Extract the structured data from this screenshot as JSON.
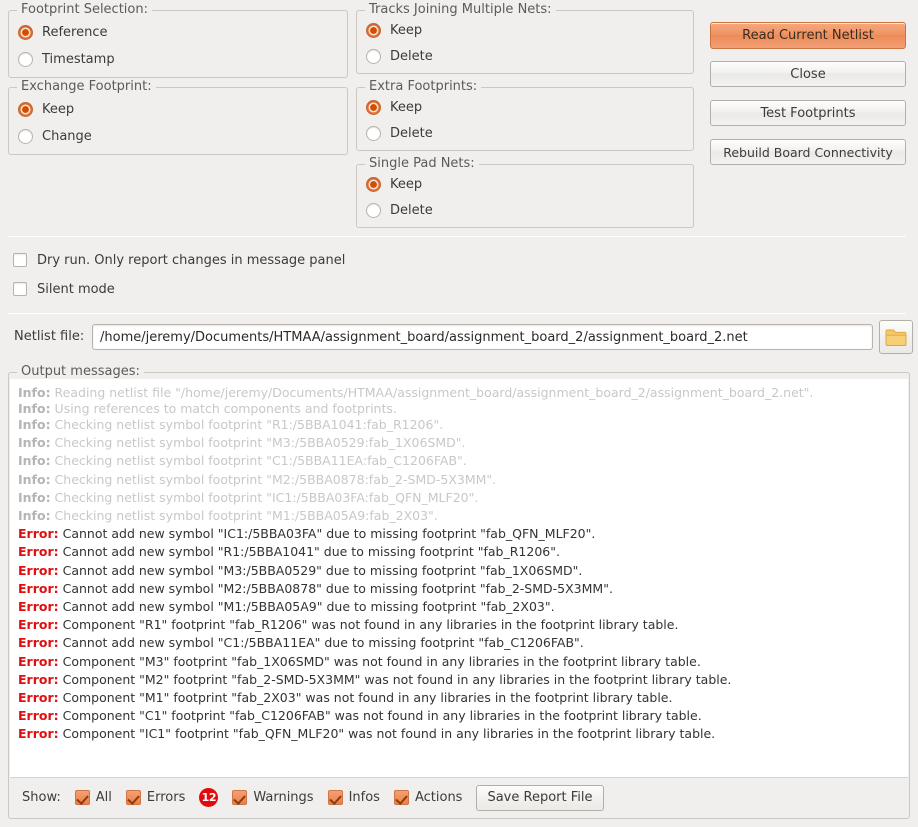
{
  "dialog": {
    "accent_color": "#ec8a57",
    "error_color": "#e10f0f",
    "info_color": "#c8c8c8"
  },
  "groups": {
    "footprint_selection": {
      "title": "Footprint Selection:",
      "options": [
        {
          "label": "Reference",
          "selected": true
        },
        {
          "label": "Timestamp",
          "selected": false
        }
      ]
    },
    "exchange_footprint": {
      "title": "Exchange Footprint:",
      "options": [
        {
          "label": "Keep",
          "selected": true
        },
        {
          "label": "Change",
          "selected": false
        }
      ]
    },
    "tracks_joining": {
      "title": "Tracks Joining Multiple Nets:",
      "options": [
        {
          "label": "Keep",
          "selected": true
        },
        {
          "label": "Delete",
          "selected": false
        }
      ]
    },
    "extra_footprints": {
      "title": "Extra Footprints:",
      "options": [
        {
          "label": "Keep",
          "selected": true
        },
        {
          "label": "Delete",
          "selected": false
        }
      ]
    },
    "single_pad_nets": {
      "title": "Single Pad Nets:",
      "options": [
        {
          "label": "Keep",
          "selected": true
        },
        {
          "label": "Delete",
          "selected": false
        }
      ]
    }
  },
  "options": {
    "dry_run": {
      "label": "Dry run. Only report changes in message panel",
      "checked": false
    },
    "silent_mode": {
      "label": "Silent mode",
      "checked": false
    }
  },
  "buttons": {
    "read_current_netlist": "Read Current Netlist",
    "close": "Close",
    "test_footprints": "Test Footprints",
    "rebuild_board_connectivity": "Rebuild Board Connectivity",
    "save_report_file": "Save Report File",
    "browse_icon": "folder-icon"
  },
  "netlist": {
    "label": "Netlist file:",
    "value": "/home/jeremy/Documents/HTMAA/assignment_board/assignment_board_2/assignment_board_2.net",
    "placeholder": ""
  },
  "output": {
    "title": "Output messages:",
    "messages": [
      {
        "level": "Info:",
        "type": "info",
        "tight": true,
        "text": " Reading netlist file \"/home/jeremy/Documents/HTMAA/assignment_board/assignment_board_2/assignment_board_2.net\"."
      },
      {
        "level": "Info:",
        "type": "info",
        "tight": true,
        "text": " Using references to match components and footprints."
      },
      {
        "level": "Info:",
        "type": "info",
        "tight": false,
        "text": " Checking netlist symbol footprint \"R1:/5BBA1041:fab_R1206\"."
      },
      {
        "level": "Info:",
        "type": "info",
        "tight": false,
        "text": " Checking netlist symbol footprint \"M3:/5BBA0529:fab_1X06SMD\"."
      },
      {
        "level": "Info:",
        "type": "info",
        "tight": false,
        "text": " Checking netlist symbol footprint \"C1:/5BBA11EA:fab_C1206FAB\"."
      },
      {
        "level": "Info:",
        "type": "info",
        "tight": false,
        "text": " Checking netlist symbol footprint \"M2:/5BBA0878:fab_2-SMD-5X3MM\"."
      },
      {
        "level": "Info:",
        "type": "info",
        "tight": false,
        "text": " Checking netlist symbol footprint \"IC1:/5BBA03FA:fab_QFN_MLF20\"."
      },
      {
        "level": "Info:",
        "type": "info",
        "tight": false,
        "text": " Checking netlist symbol footprint \"M1:/5BBA05A9:fab_2X03\"."
      },
      {
        "level": "Error:",
        "type": "error",
        "tight": false,
        "text": " Cannot add new symbol \"IC1:/5BBA03FA\" due to missing footprint \"fab_QFN_MLF20\"."
      },
      {
        "level": "Error:",
        "type": "error",
        "tight": false,
        "text": " Cannot add new symbol \"R1:/5BBA1041\" due to missing footprint \"fab_R1206\"."
      },
      {
        "level": "Error:",
        "type": "error",
        "tight": false,
        "text": " Cannot add new symbol \"M3:/5BBA0529\" due to missing footprint \"fab_1X06SMD\"."
      },
      {
        "level": "Error:",
        "type": "error",
        "tight": false,
        "text": " Cannot add new symbol \"M2:/5BBA0878\" due to missing footprint \"fab_2-SMD-5X3MM\"."
      },
      {
        "level": "Error:",
        "type": "error",
        "tight": false,
        "text": " Cannot add new symbol \"M1:/5BBA05A9\" due to missing footprint \"fab_2X03\"."
      },
      {
        "level": "Error:",
        "type": "error",
        "tight": false,
        "text": " Component \"R1\" footprint \"fab_R1206\" was not found in any libraries in the footprint library table."
      },
      {
        "level": "Error:",
        "type": "error",
        "tight": false,
        "text": " Cannot add new symbol \"C1:/5BBA11EA\" due to missing footprint \"fab_C1206FAB\"."
      },
      {
        "level": "Error:",
        "type": "error",
        "tight": false,
        "text": " Component \"M3\" footprint \"fab_1X06SMD\" was not found in any libraries in the footprint library table."
      },
      {
        "level": "Error:",
        "type": "error",
        "tight": false,
        "text": " Component \"M2\" footprint \"fab_2-SMD-5X3MM\" was not found in any libraries in the footprint library table."
      },
      {
        "level": "Error:",
        "type": "error",
        "tight": false,
        "text": " Component \"M1\" footprint \"fab_2X03\" was not found in any libraries in the footprint library table."
      },
      {
        "level": "Error:",
        "type": "error",
        "tight": false,
        "text": " Component \"C1\" footprint \"fab_C1206FAB\" was not found in any libraries in the footprint library table."
      },
      {
        "level": "Error:",
        "type": "error",
        "tight": false,
        "text": " Component \"IC1\" footprint \"fab_QFN_MLF20\" was not found in any libraries in the footprint library table."
      }
    ]
  },
  "showbar": {
    "label": "Show:",
    "filters": [
      {
        "label": "All",
        "checked": true
      },
      {
        "label": "Errors",
        "checked": true
      },
      {
        "label": "Warnings",
        "checked": true
      },
      {
        "label": "Infos",
        "checked": true
      },
      {
        "label": "Actions",
        "checked": true
      }
    ],
    "error_count": "12"
  }
}
